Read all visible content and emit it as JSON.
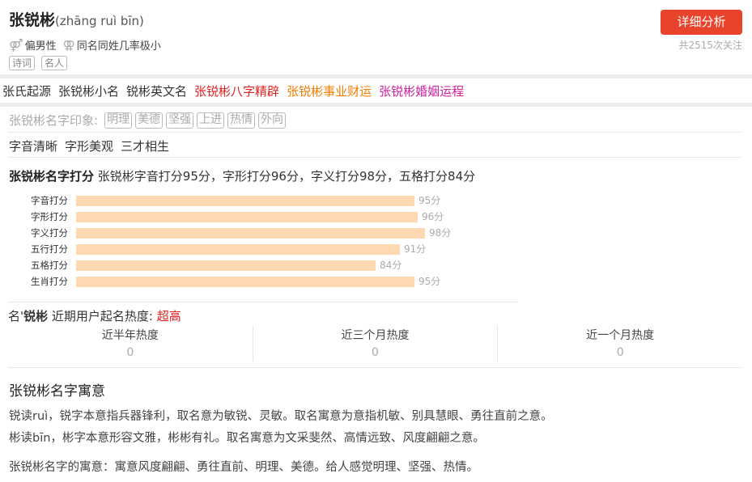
{
  "header": {
    "name": "张锐彬",
    "pinyin": "(zhāng ruì bīn)",
    "gender_symbol": "⚤",
    "gender": "偏男性",
    "same_name_symbol": "⚢",
    "same_name": "同名同姓几率极小",
    "tags": [
      "诗词",
      "名人"
    ],
    "detail_button": "详细分析",
    "follow_count": "共2515次关注"
  },
  "nav": {
    "items": [
      {
        "label": "张氏起源",
        "color": "#333333"
      },
      {
        "label": "张锐彬小名",
        "color": "#333333"
      },
      {
        "label": "锐彬英文名",
        "color": "#333333"
      },
      {
        "label": "张锐彬八字精辟",
        "color": "#e02020"
      },
      {
        "label": "张锐彬事业财运",
        "color": "#f07c00"
      },
      {
        "label": "张锐彬婚姻运程",
        "color": "#d01fa0"
      }
    ]
  },
  "impression": {
    "label": "张锐彬名字印象:",
    "tags": [
      "明理",
      "美德",
      "坚强",
      "上进",
      "热情",
      "外向"
    ]
  },
  "features": [
    "字音清晰",
    "字形美观",
    "三才相生"
  ],
  "score": {
    "title": "张锐彬名字打分",
    "summary": "张锐彬字音打分95分，字形打分96分，字义打分98分，五格打分84分",
    "bars": [
      {
        "label": "字音打分",
        "value": 95,
        "text": "95分"
      },
      {
        "label": "字形打分",
        "value": 96,
        "text": "96分"
      },
      {
        "label": "字义打分",
        "value": 98,
        "text": "98分"
      },
      {
        "label": "五行打分",
        "value": 91,
        "text": "91分"
      },
      {
        "label": "五格打分",
        "value": 84,
        "text": "84分"
      },
      {
        "label": "生肖打分",
        "value": 95,
        "text": "95分"
      }
    ]
  },
  "popularity": {
    "prefix": "名'",
    "name": "锐彬",
    "middle": "近期用户起名热度:",
    "level": "超高",
    "stats": [
      {
        "label": "近半年热度",
        "value": "0"
      },
      {
        "label": "近三个月热度",
        "value": "0"
      },
      {
        "label": "近一个月热度",
        "value": "0"
      }
    ]
  },
  "meaning": {
    "title": "张锐彬名字寓意",
    "line1": "锐读ruì，锐字本意指兵器锋利，取名意为敏锐、灵敏。取名寓意为意指机敏、别具慧眼、勇往直前之意。",
    "line2": "彬读bīn，彬字本意形容文雅，彬彬有礼。取名寓意为文采斐然、高情远致、风度翩翩之意。",
    "line3": "张锐彬名字的寓意：寓意风度翩翩、勇往直前、明理、美德。给人感觉明理、坚强、热情。"
  }
}
